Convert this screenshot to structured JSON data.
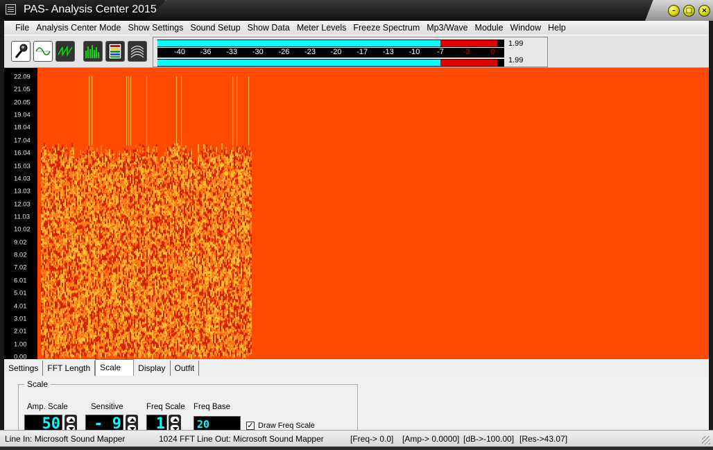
{
  "window": {
    "title": "PAS- Analysis Center 2015",
    "controls": [
      "minimize",
      "maximize",
      "close"
    ]
  },
  "menu": {
    "items": [
      "File",
      "Analysis Center Mode",
      "Show Settings",
      "Sound Setup",
      "Show Data",
      "Meter Levels",
      "Freeze Spectrum",
      "Mp3/Wave",
      "Module",
      "Window",
      "Help"
    ]
  },
  "toolbar": {
    "buttons": [
      "microphone-icon",
      "sine-wave-icon",
      "sawtooth-wave-icon",
      "spectrum-bars-icon",
      "level-meter-icon",
      "waterfall-icon"
    ]
  },
  "meter": {
    "scale": [
      "-40",
      "-36",
      "-33",
      "-30",
      "-26",
      "-23",
      "-20",
      "-17",
      "-13",
      "-10",
      "-7",
      "-3",
      "0"
    ],
    "left_value": "1.99",
    "right_value": "1.99",
    "left_level_fraction": 0.82,
    "right_level_fraction": 0.82,
    "colors": {
      "low": "#00ffff",
      "high": "#e00000"
    }
  },
  "spectrogram": {
    "freq_axis": [
      "22.09",
      "21.05",
      "20.05",
      "19.04",
      "18.04",
      "17.04",
      "16.04",
      "15.03",
      "14.03",
      "13.03",
      "12.03",
      "11.03",
      "10.02",
      "9.02",
      "8.02",
      "7.02",
      "6.01",
      "5.01",
      "4.01",
      "3.01",
      "2.01",
      "1.00",
      "0.00"
    ],
    "background_color": "#ff4a00"
  },
  "tabs": {
    "items": [
      "Settings",
      "FFT Length",
      "Scale",
      "Display",
      "Outfit"
    ],
    "active": "Scale"
  },
  "scale_panel": {
    "group_title": "Scale",
    "amp_scale": {
      "label": "Amp. Scale",
      "value": "50"
    },
    "sensitive": {
      "label": "Sensitive",
      "value": "- 9"
    },
    "freq_scale": {
      "label": "Freq Scale",
      "value": "1"
    },
    "freq_base": {
      "label": "Freq Base",
      "value": "20"
    },
    "draw_freq_scale": {
      "label": "Draw Freq Scale",
      "checked": true,
      "mark": "✓"
    }
  },
  "status": {
    "line_in": "Line In: Microsoft Sound Mapper",
    "fft": "1024 FFT",
    "line_out": "Line Out: Microsoft Sound Mapper",
    "freq": "[Freq->      0.0]",
    "amp": "[Amp-> 0.0000]",
    "db": "[dB->-100.00]",
    "res": "[Res->43.07]"
  }
}
